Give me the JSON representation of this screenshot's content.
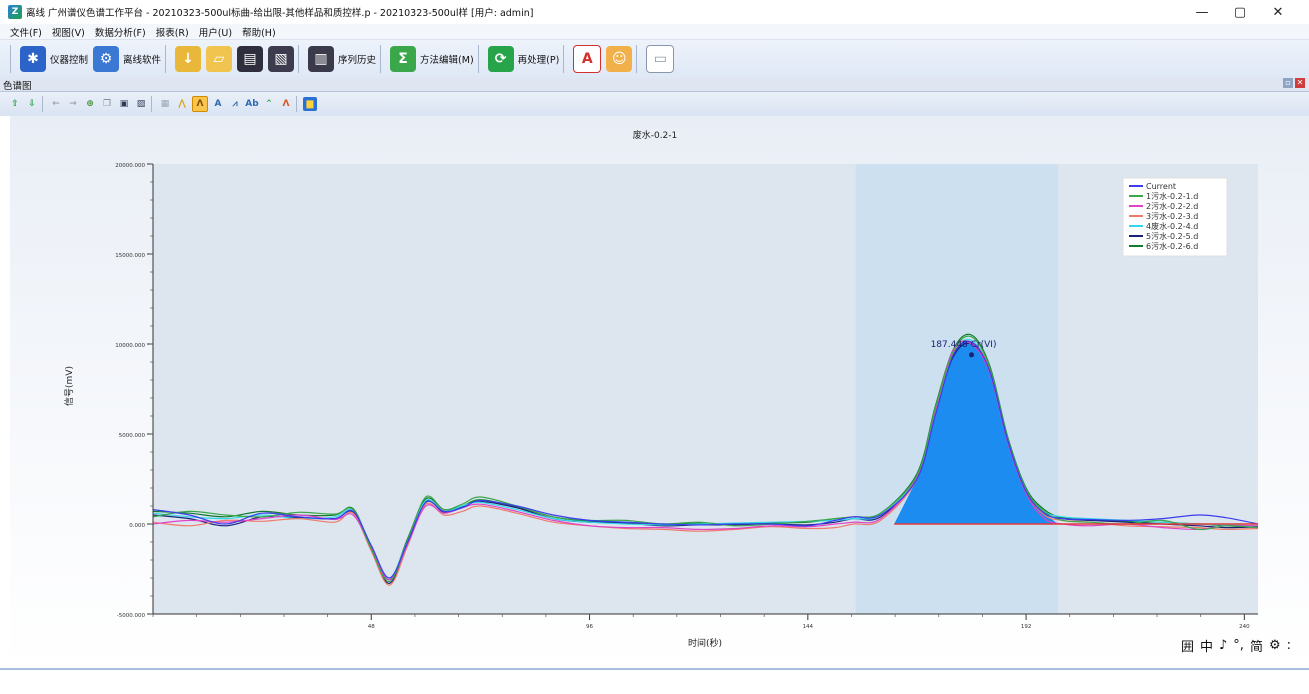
{
  "window": {
    "title": "离线 广州谱仪色谱工作平台 - 20210323-500ul标曲-给出限-其他样品和质控样.p - 20210323-500ul样 [用户: admin]",
    "controls": {
      "minimize": "—",
      "maximize": "▢",
      "close": "✕"
    }
  },
  "menu": [
    "文件(F)",
    "视图(V)",
    "数据分析(F)",
    "报表(R)",
    "用户(U)",
    "帮助(H)"
  ],
  "toolbar": {
    "instrument_control": "仪器控制",
    "offline_software": "离线软件",
    "sequence_history": "序列历史",
    "method_edit": "方法编辑(M)",
    "reprocess": "再处理(P)"
  },
  "panel": {
    "title": "色谱图"
  },
  "chart_data": {
    "type": "line",
    "title": "废水-0.2-1",
    "xlabel": "时间(秒)",
    "ylabel": "信号(mV)",
    "xlim": [
      0,
      243
    ],
    "ylim": [
      -5000,
      20000
    ],
    "x_ticks": [
      {
        "value": 48,
        "label": "48"
      },
      {
        "value": 96,
        "label": "96"
      },
      {
        "value": 144,
        "label": "144"
      },
      {
        "value": 192,
        "label": "192"
      },
      {
        "value": 240,
        "label": "240"
      }
    ],
    "y_ticks": [
      {
        "value": -5000,
        "label": "-5000.000"
      },
      {
        "value": 0,
        "label": "0.000"
      },
      {
        "value": 5000,
        "label": "5000.000"
      },
      {
        "value": 10000,
        "label": "10000.000"
      },
      {
        "value": 15000,
        "label": "15000.000"
      },
      {
        "value": 20000,
        "label": "20000.000"
      }
    ],
    "integration_window": [
      154.5,
      199
    ],
    "peak": {
      "label": "187.448 Cr(VI)",
      "apex_x": 180,
      "apex_y": 9400,
      "start_x": 163,
      "end_x": 199
    },
    "legend_position": "top-right",
    "series": [
      {
        "name": "Current",
        "color": "#3c3cf0",
        "offset": 150,
        "peak": 10100,
        "points": [
          [
            0,
            800
          ],
          [
            8,
            500
          ],
          [
            16,
            0
          ],
          [
            24,
            600
          ],
          [
            32,
            400
          ],
          [
            40,
            300
          ],
          [
            44,
            700
          ],
          [
            48,
            -1200
          ],
          [
            52,
            -3000
          ],
          [
            56,
            -1000
          ],
          [
            60,
            1200
          ],
          [
            64,
            700
          ],
          [
            68,
            900
          ],
          [
            72,
            1300
          ],
          [
            80,
            1000
          ],
          [
            88,
            500
          ],
          [
            96,
            200
          ],
          [
            104,
            100
          ],
          [
            112,
            0
          ],
          [
            120,
            -50
          ],
          [
            128,
            0
          ],
          [
            136,
            0
          ],
          [
            144,
            -100
          ],
          [
            150,
            200
          ],
          [
            154,
            400
          ],
          [
            160,
            500
          ],
          [
            168,
            2500
          ],
          [
            172,
            6000
          ],
          [
            176,
            9400
          ],
          [
            180,
            10100
          ],
          [
            184,
            8500
          ],
          [
            188,
            4600
          ],
          [
            192,
            1800
          ],
          [
            196,
            600
          ],
          [
            200,
            300
          ],
          [
            206,
            250
          ],
          [
            214,
            200
          ],
          [
            222,
            300
          ],
          [
            230,
            500
          ],
          [
            236,
            350
          ],
          [
            243,
            0
          ]
        ]
      },
      {
        "name": "1污水-0.2-1.d",
        "color": "#3aa84a",
        "offset": -100,
        "peak": 10000,
        "points": [
          [
            0,
            400
          ],
          [
            8,
            700
          ],
          [
            16,
            500
          ],
          [
            24,
            400
          ],
          [
            32,
            650
          ],
          [
            40,
            550
          ],
          [
            44,
            800
          ],
          [
            48,
            -1400
          ],
          [
            52,
            -3200
          ],
          [
            56,
            -900
          ],
          [
            60,
            1500
          ],
          [
            64,
            800
          ],
          [
            68,
            1100
          ],
          [
            72,
            1500
          ],
          [
            80,
            1000
          ],
          [
            88,
            400
          ],
          [
            96,
            200
          ],
          [
            104,
            200
          ],
          [
            112,
            0
          ],
          [
            120,
            100
          ],
          [
            128,
            -100
          ],
          [
            136,
            0
          ],
          [
            144,
            150
          ],
          [
            150,
            300
          ],
          [
            154,
            400
          ],
          [
            160,
            600
          ],
          [
            168,
            2700
          ],
          [
            172,
            6400
          ],
          [
            176,
            9600
          ],
          [
            180,
            10400
          ],
          [
            184,
            8700
          ],
          [
            188,
            4700
          ],
          [
            192,
            1900
          ],
          [
            196,
            700
          ],
          [
            200,
            200
          ],
          [
            206,
            100
          ],
          [
            214,
            0
          ],
          [
            222,
            200
          ],
          [
            230,
            -300
          ],
          [
            236,
            -100
          ],
          [
            243,
            -200
          ]
        ]
      },
      {
        "name": "2污水-0.2-2.d",
        "color": "#e043c8",
        "offset": 200,
        "peak": 9800,
        "points": [
          [
            0,
            0
          ],
          [
            8,
            200
          ],
          [
            16,
            100
          ],
          [
            24,
            300
          ],
          [
            32,
            500
          ],
          [
            40,
            250
          ],
          [
            44,
            500
          ],
          [
            48,
            -1300
          ],
          [
            52,
            -3100
          ],
          [
            56,
            -1100
          ],
          [
            60,
            1000
          ],
          [
            64,
            600
          ],
          [
            68,
            900
          ],
          [
            72,
            1100
          ],
          [
            80,
            700
          ],
          [
            88,
            200
          ],
          [
            96,
            -100
          ],
          [
            104,
            -200
          ],
          [
            112,
            -200
          ],
          [
            120,
            -300
          ],
          [
            128,
            -250
          ],
          [
            136,
            -100
          ],
          [
            144,
            -150
          ],
          [
            150,
            0
          ],
          [
            154,
            100
          ],
          [
            160,
            300
          ],
          [
            168,
            2600
          ],
          [
            172,
            6300
          ],
          [
            176,
            9700
          ],
          [
            180,
            10000
          ],
          [
            184,
            8400
          ],
          [
            188,
            4500
          ],
          [
            192,
            1700
          ],
          [
            196,
            300
          ],
          [
            200,
            0
          ],
          [
            206,
            -100
          ],
          [
            214,
            0
          ],
          [
            222,
            -200
          ],
          [
            230,
            -300
          ],
          [
            236,
            -100
          ],
          [
            243,
            -100
          ]
        ]
      },
      {
        "name": "3污水-0.2-3.d",
        "color": "#f07a6a",
        "offset": 0,
        "peak": 9600,
        "points": [
          [
            0,
            100
          ],
          [
            8,
            -100
          ],
          [
            16,
            200
          ],
          [
            24,
            150
          ],
          [
            32,
            300
          ],
          [
            40,
            100
          ],
          [
            44,
            600
          ],
          [
            48,
            -1500
          ],
          [
            52,
            -3400
          ],
          [
            56,
            -1200
          ],
          [
            60,
            1100
          ],
          [
            64,
            500
          ],
          [
            68,
            700
          ],
          [
            72,
            1000
          ],
          [
            80,
            600
          ],
          [
            88,
            100
          ],
          [
            96,
            -100
          ],
          [
            104,
            -250
          ],
          [
            112,
            -300
          ],
          [
            120,
            -400
          ],
          [
            128,
            -300
          ],
          [
            136,
            -150
          ],
          [
            144,
            -250
          ],
          [
            150,
            -200
          ],
          [
            154,
            0
          ],
          [
            160,
            200
          ],
          [
            168,
            2500
          ],
          [
            172,
            6200
          ],
          [
            176,
            9500
          ],
          [
            180,
            10100
          ],
          [
            184,
            8600
          ],
          [
            188,
            4600
          ],
          [
            192,
            1800
          ],
          [
            196,
            500
          ],
          [
            200,
            200
          ],
          [
            206,
            100
          ],
          [
            214,
            -100
          ],
          [
            222,
            -150
          ],
          [
            230,
            -200
          ],
          [
            236,
            -300
          ],
          [
            243,
            -250
          ]
        ]
      },
      {
        "name": "4废水-0.2-4.d",
        "color": "#33d8e8",
        "offset": 0,
        "peak": 9700,
        "points": [
          [
            0,
            600
          ],
          [
            8,
            400
          ],
          [
            16,
            300
          ],
          [
            24,
            500
          ],
          [
            32,
            300
          ],
          [
            40,
            400
          ],
          [
            44,
            750
          ],
          [
            48,
            -1200
          ],
          [
            52,
            -3000
          ],
          [
            56,
            -900
          ],
          [
            60,
            1300
          ],
          [
            64,
            700
          ],
          [
            68,
            1000
          ],
          [
            72,
            1200
          ],
          [
            80,
            800
          ],
          [
            88,
            300
          ],
          [
            96,
            100
          ],
          [
            104,
            0
          ],
          [
            112,
            -50
          ],
          [
            120,
            0
          ],
          [
            128,
            50
          ],
          [
            136,
            100
          ],
          [
            144,
            150
          ],
          [
            150,
            200
          ],
          [
            154,
            300
          ],
          [
            160,
            500
          ],
          [
            168,
            2600
          ],
          [
            172,
            6300
          ],
          [
            176,
            9500
          ],
          [
            180,
            10200
          ],
          [
            184,
            8600
          ],
          [
            188,
            4700
          ],
          [
            192,
            1900
          ],
          [
            196,
            700
          ],
          [
            200,
            400
          ],
          [
            206,
            300
          ],
          [
            214,
            200
          ],
          [
            222,
            100
          ],
          [
            230,
            0
          ],
          [
            236,
            -50
          ],
          [
            243,
            -100
          ]
        ]
      },
      {
        "name": "5污水-0.2-5.d",
        "color": "#1a2277",
        "offset": 0,
        "peak": 9900,
        "points": [
          [
            0,
            500
          ],
          [
            8,
            300
          ],
          [
            16,
            -100
          ],
          [
            24,
            400
          ],
          [
            32,
            350
          ],
          [
            40,
            300
          ],
          [
            44,
            650
          ],
          [
            48,
            -1400
          ],
          [
            52,
            -3300
          ],
          [
            56,
            -1000
          ],
          [
            60,
            1250
          ],
          [
            64,
            650
          ],
          [
            68,
            950
          ],
          [
            72,
            1250
          ],
          [
            80,
            900
          ],
          [
            88,
            300
          ],
          [
            96,
            100
          ],
          [
            104,
            50
          ],
          [
            112,
            -100
          ],
          [
            120,
            -50
          ],
          [
            128,
            -50
          ],
          [
            136,
            0
          ],
          [
            144,
            -50
          ],
          [
            150,
            100
          ],
          [
            154,
            300
          ],
          [
            160,
            400
          ],
          [
            168,
            2600
          ],
          [
            172,
            6200
          ],
          [
            176,
            9300
          ],
          [
            180,
            10000
          ],
          [
            184,
            8500
          ],
          [
            188,
            4600
          ],
          [
            192,
            1800
          ],
          [
            196,
            600
          ],
          [
            200,
            300
          ],
          [
            206,
            200
          ],
          [
            214,
            100
          ],
          [
            222,
            0
          ],
          [
            230,
            -100
          ],
          [
            236,
            -200
          ],
          [
            243,
            -150
          ]
        ]
      },
      {
        "name": "6污水-0.2-6.d",
        "color": "#137a2e",
        "offset": 0,
        "peak": 10000,
        "points": [
          [
            0,
            700
          ],
          [
            8,
            600
          ],
          [
            16,
            400
          ],
          [
            24,
            700
          ],
          [
            32,
            500
          ],
          [
            40,
            500
          ],
          [
            44,
            850
          ],
          [
            48,
            -1300
          ],
          [
            52,
            -3100
          ],
          [
            56,
            -800
          ],
          [
            60,
            1400
          ],
          [
            64,
            800
          ],
          [
            68,
            1000
          ],
          [
            72,
            1350
          ],
          [
            80,
            950
          ],
          [
            88,
            400
          ],
          [
            96,
            150
          ],
          [
            104,
            100
          ],
          [
            112,
            0
          ],
          [
            120,
            50
          ],
          [
            128,
            0
          ],
          [
            136,
            50
          ],
          [
            144,
            100
          ],
          [
            150,
            300
          ],
          [
            154,
            400
          ],
          [
            160,
            600
          ],
          [
            168,
            2800
          ],
          [
            172,
            6500
          ],
          [
            176,
            9700
          ],
          [
            180,
            10500
          ],
          [
            184,
            8800
          ],
          [
            188,
            4800
          ],
          [
            192,
            2000
          ],
          [
            196,
            800
          ],
          [
            200,
            350
          ],
          [
            206,
            250
          ],
          [
            214,
            150
          ],
          [
            222,
            100
          ],
          [
            230,
            0
          ],
          [
            236,
            -100
          ],
          [
            243,
            -200
          ]
        ]
      }
    ]
  },
  "bottom_toolbar": [
    "囲",
    "中",
    "♪",
    "°,",
    "简",
    "⚙",
    ":"
  ]
}
